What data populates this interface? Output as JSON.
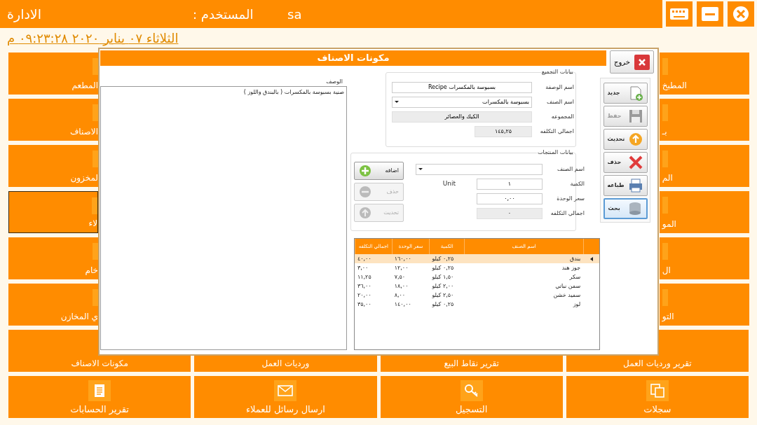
{
  "header": {
    "title": "الادارة",
    "user_label": "المستخدم :",
    "user": "sa"
  },
  "window_controls": [
    {
      "kind": "keyboard"
    },
    {
      "kind": "minimize"
    },
    {
      "kind": "close"
    }
  ],
  "datetime": "الثلاثاء ٠٧ يناير ٢٠٢٠ ٠٩:٢٣:٢٨ م",
  "left_tiles": [
    {
      "label": "المطعم",
      "focused": false
    },
    {
      "label": "الاصناف",
      "focused": false
    },
    {
      "label": "لمخزون",
      "focused": false
    },
    {
      "label": "لاء",
      "focused": true
    },
    {
      "label": "خام",
      "focused": false
    },
    {
      "label": "ي المخازن",
      "focused": false
    }
  ],
  "right_tiles": [
    {
      "label": "المطبخ"
    },
    {
      "label": "بـ"
    },
    {
      "label": "الم"
    },
    {
      "label": "المو"
    },
    {
      "label": "ال"
    },
    {
      "label": "التو"
    }
  ],
  "report_tiles": [
    {
      "label": "تقرير ورديات العمل"
    },
    {
      "label": "تقرير نقاط البيع"
    },
    {
      "label": "ورديات العمل"
    },
    {
      "label": "مكونات الاصناف"
    }
  ],
  "menu_tiles": [
    {
      "label": "سجلات",
      "kind": "copy"
    },
    {
      "label": "التسجيل",
      "kind": "key"
    },
    {
      "label": "ارسال رسائل للعملاء",
      "kind": "mail"
    },
    {
      "label": "تقرير الحسابات",
      "kind": "report"
    }
  ],
  "dialog": {
    "title": "مكونات الاصناف",
    "exit_button": "خروج",
    "description_label": "الوصف",
    "description": "صنية بسبوسة بالمكسرات ( بالبندق واللوز )",
    "assembly_group": {
      "title": "بيانات التجميع",
      "fields": [
        {
          "label": "اسم الوصفة",
          "value": "بسبوسة بالمكسرات Recipe",
          "kind": "text"
        },
        {
          "label": "اسم الصنف",
          "value": "بسبوسة بالمكسرات",
          "kind": "dropdown"
        },
        {
          "label": "المجموعه",
          "value": "الكيك والعصائر",
          "kind": "readonly"
        },
        {
          "label": "اجمالي التكلفه",
          "value": "١٤٥,٢٥",
          "kind": "readonly"
        }
      ]
    },
    "products_group": {
      "title": "بيانات المنتجات",
      "fields": [
        {
          "label": "اسم الصنف",
          "kind": "dropdown"
        },
        {
          "label": "الكمية",
          "value": "١",
          "kind": "text",
          "unit": "Unit"
        },
        {
          "label": "سعر الوحدة",
          "value": "٠,٠٠",
          "kind": "text"
        },
        {
          "label": "اجمالي التكلفه",
          "value": "٠",
          "kind": "readonly"
        }
      ],
      "buttons": [
        {
          "label": "اضافه",
          "kind": "add",
          "disabled": false
        },
        {
          "label": "حذف",
          "kind": "remove",
          "disabled": true
        },
        {
          "label": "تحديث",
          "kind": "refresh",
          "disabled": true
        }
      ]
    },
    "toolbar": [
      {
        "label": "جديد",
        "kind": "new",
        "disabled": false,
        "focused": false
      },
      {
        "label": "حفظ",
        "kind": "save",
        "disabled": true,
        "focused": false
      },
      {
        "label": "تحديث",
        "kind": "refresh",
        "disabled": false,
        "focused": false
      },
      {
        "label": "حذف",
        "kind": "delete",
        "disabled": false,
        "focused": false
      },
      {
        "label": "طباعه",
        "kind": "print",
        "disabled": false,
        "focused": false
      },
      {
        "label": "بحث",
        "kind": "search",
        "disabled": false,
        "focused": true
      }
    ],
    "table": {
      "columns": [
        "اسم الصنف",
        "الكمية",
        "سعر الوحدة",
        "اجمالي التكلفه"
      ],
      "rows": [
        {
          "cells": [
            "بندق",
            "٠,٢٥ كيلو",
            "١٦٠,٠٠",
            "٤٠,٠٠"
          ],
          "selected": true
        },
        {
          "cells": [
            "جوز هند",
            "٠,٢٥ كيلو",
            "١٢,٠٠",
            "٣,٠٠"
          ],
          "selected": false
        },
        {
          "cells": [
            "سكر",
            "١,٥٠ كيلو",
            "٧,٥٠",
            "١١,٢٥"
          ],
          "selected": false
        },
        {
          "cells": [
            "سمن نباتي",
            "٢,٠٠ كيلو",
            "١٨,٠٠",
            "٣٦,٠٠"
          ],
          "selected": false
        },
        {
          "cells": [
            "سميد خشن",
            "٢,٥٠ كيلو",
            "٨,٠٠",
            "٢٠,٠٠"
          ],
          "selected": false
        },
        {
          "cells": [
            "لوز",
            "٠,٢٥ كيلو",
            "١٤٠,٠٠",
            "٣٥,٠٠"
          ],
          "selected": false
        }
      ]
    }
  }
}
